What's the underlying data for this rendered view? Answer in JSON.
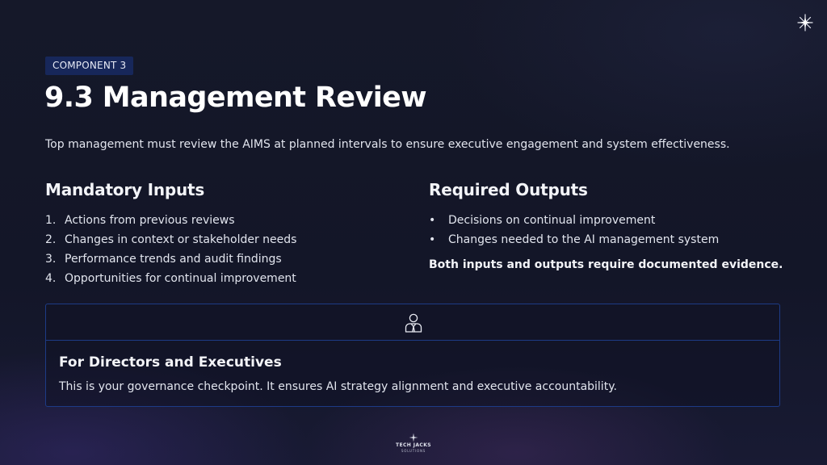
{
  "slide": {
    "badge": "COMPONENT 3",
    "title": "9.3 Management Review",
    "intro": "Top management must review the AIMS at planned intervals to ensure executive engagement and system effectiveness."
  },
  "inputs": {
    "heading": "Mandatory Inputs",
    "items": [
      {
        "marker": "1.",
        "text": "Actions from previous reviews"
      },
      {
        "marker": "2.",
        "text": "Changes in context or stakeholder needs"
      },
      {
        "marker": "3.",
        "text": "Performance trends and audit findings"
      },
      {
        "marker": "4.",
        "text": "Opportunities for continual improvement"
      }
    ]
  },
  "outputs": {
    "heading": "Required Outputs",
    "items": [
      {
        "marker": "•",
        "text": "Decisions on continual improvement"
      },
      {
        "marker": "•",
        "text": "Changes needed to the AI management system"
      }
    ],
    "note": "Both inputs and outputs require documented evidence."
  },
  "callout": {
    "icon": "executive-person-icon",
    "heading": "For Directors and Executives",
    "body": "This is your governance checkpoint. It ensures AI strategy alignment and executive accountability."
  },
  "branding": {
    "corner_icon": "sparkle-star-icon",
    "logo_icon": "sparkle-star-icon",
    "logo_name": "TECH JACKS",
    "logo_sub": "SOLUTIONS"
  },
  "colors": {
    "background": "#14172a",
    "badge_background": "#17275a",
    "callout_border": "#1d3b86",
    "text": "#e2e5ee",
    "heading": "#ffffff"
  }
}
